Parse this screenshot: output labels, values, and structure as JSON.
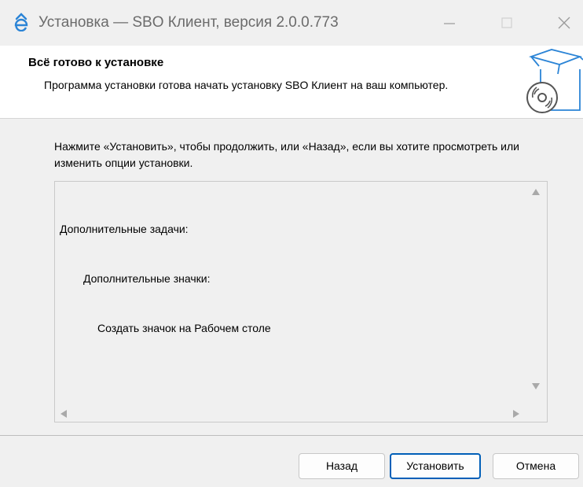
{
  "window": {
    "title": "Установка — SBO Клиент, версия 2.0.0.773",
    "icons": [
      "app-logo-icon",
      "minimize-icon",
      "maximize-icon",
      "close-icon"
    ]
  },
  "header": {
    "title": "Всё готово к установке",
    "description": "Программа установки готова начать установку SBO Клиент на ваш компьютер.",
    "image": "box-with-disc-icon"
  },
  "main": {
    "intro": "Нажмите «Установить», чтобы продолжить, или «Назад», если вы хотите просмотреть или изменить опции установки.",
    "memo": {
      "lines": [
        "Дополнительные задачи:",
        "Дополнительные значки:",
        "Создать значок на Рабочем столе"
      ]
    }
  },
  "buttons": {
    "back": "Назад",
    "install": "Установить",
    "cancel": "Отмена"
  },
  "colors": {
    "accent": "#005fb8",
    "icon_blue": "#2b84d6"
  }
}
